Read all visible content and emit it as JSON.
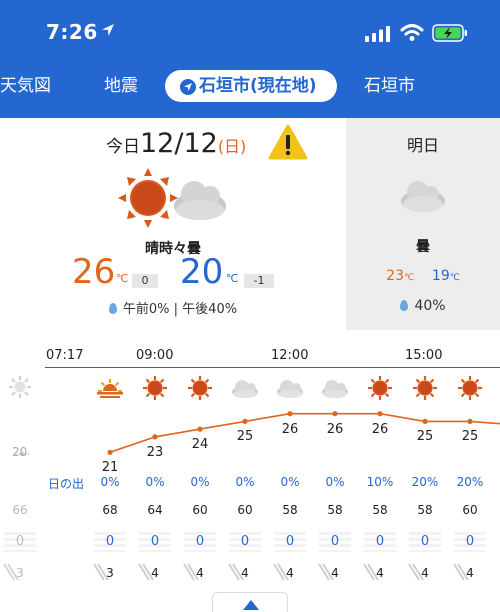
{
  "status_bar": {
    "time": "7:26"
  },
  "nav": {
    "tabs": [
      {
        "label": "天気図"
      },
      {
        "label": "地震"
      },
      {
        "label": "石垣市(現在地)",
        "active": true
      },
      {
        "label": "石垣市"
      }
    ]
  },
  "today": {
    "prefix": "今日",
    "date": "12/12",
    "dow": "(日)",
    "condition": "晴時々曇",
    "high": "26",
    "high_unit": "℃",
    "high_diff": "0",
    "low": "20",
    "low_unit": "℃",
    "low_diff": "-1",
    "precip": "午前0% | 午後40%",
    "icon": "sun-cloud-icon"
  },
  "tomorrow": {
    "label": "明日",
    "condition": "曇",
    "high": "23",
    "low": "19",
    "unit": "℃",
    "precip": "40%",
    "icon": "cloud-icon"
  },
  "hourly": {
    "hour_labels": [
      "07:17",
      "09:00",
      "12:00",
      "15:00"
    ],
    "sunrise_label": "日の出",
    "scale_label": "20",
    "partial_left": {
      "humidity": "66",
      "rain": "0",
      "wind": "3"
    },
    "columns": [
      {
        "icon": "sunrise-icon",
        "temp": "21",
        "precip": "0%",
        "humidity": "68",
        "rain": "0",
        "wind": "3"
      },
      {
        "icon": "sun-icon",
        "temp": "23",
        "precip": "0%",
        "humidity": "64",
        "rain": "0",
        "wind": "4"
      },
      {
        "icon": "sun-icon",
        "temp": "24",
        "precip": "0%",
        "humidity": "60",
        "rain": "0",
        "wind": "4"
      },
      {
        "icon": "cloud-icon",
        "temp": "25",
        "precip": "0%",
        "humidity": "60",
        "rain": "0",
        "wind": "4"
      },
      {
        "icon": "cloud-icon",
        "temp": "26",
        "precip": "0%",
        "humidity": "58",
        "rain": "0",
        "wind": "4"
      },
      {
        "icon": "cloud-icon",
        "temp": "26",
        "precip": "0%",
        "humidity": "58",
        "rain": "0",
        "wind": "4"
      },
      {
        "icon": "sun-icon",
        "temp": "26",
        "precip": "10%",
        "humidity": "58",
        "rain": "0",
        "wind": "4"
      },
      {
        "icon": "sun-icon",
        "temp": "25",
        "precip": "20%",
        "humidity": "58",
        "rain": "0",
        "wind": "4"
      },
      {
        "icon": "sun-icon",
        "temp": "25",
        "precip": "20%",
        "humidity": "60",
        "rain": "0",
        "wind": "4"
      }
    ]
  },
  "colors": {
    "brand_blue": "#2567d0",
    "high_orange": "#e0651e",
    "low_blue": "#2567d0",
    "graph_line": "#e0651e"
  }
}
